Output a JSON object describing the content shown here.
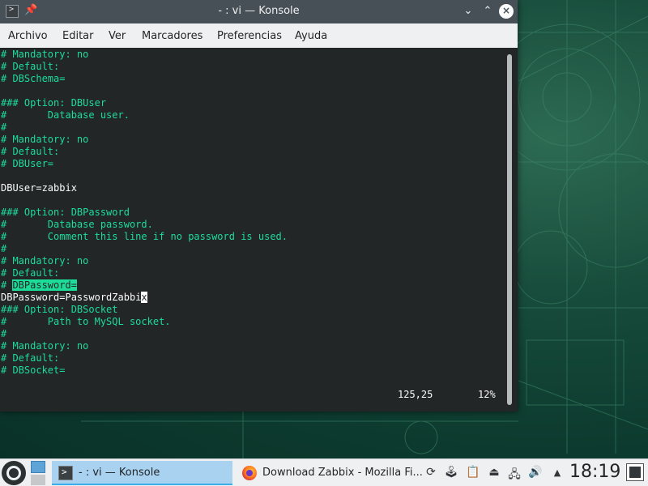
{
  "window": {
    "title": "- : vi — Konsole",
    "pin_icon": "📌",
    "minimize_icon": "⌄",
    "maximize_icon": "⌃",
    "close_icon": "×",
    "app_icon": ">"
  },
  "menubar": {
    "items": [
      "Archivo",
      "Editar",
      "Ver",
      "Marcadores",
      "Preferencias",
      "Ayuda"
    ]
  },
  "terminal": {
    "lines": [
      "# Mandatory: no",
      "# Default:",
      "# DBSchema=",
      "",
      "### Option: DBUser",
      "#       Database user.",
      "#",
      "# Mandatory: no",
      "# Default:",
      "# DBUser=",
      "",
      "DBUser=zabbix",
      "",
      "### Option: DBPassword",
      "#       Database password.",
      "#       Comment this line if no password is used.",
      "#",
      "# Mandatory: no",
      "# Default:",
      "# ",
      "DBPassword=PasswordZabbi",
      "### Option: DBSocket",
      "#       Path to MySQL socket.",
      "#",
      "# Mandatory: no",
      "# Default:",
      "# DBSocket="
    ],
    "highlighted_text": "DBPassword=",
    "cursor_char": "x",
    "status_position": "125,25",
    "status_percent": "12%"
  },
  "taskbar": {
    "tasks": [
      {
        "label": "- : vi — Konsole",
        "icon": "konsole-icon",
        "active": true
      },
      {
        "label": "Download Zabbix - Mozilla Fi...",
        "icon": "firefox-icon",
        "active": false
      }
    ],
    "tray_icons": [
      "updates-icon",
      "gamepad-icon",
      "clipboard-icon",
      "usb-icon",
      "network-icon",
      "volume-icon",
      "expand-tray-icon"
    ],
    "tray_glyphs": [
      "⟳",
      "🕹",
      "📋",
      "⏏",
      "🖧",
      "🔊",
      "▲"
    ],
    "clock": "18:19"
  }
}
